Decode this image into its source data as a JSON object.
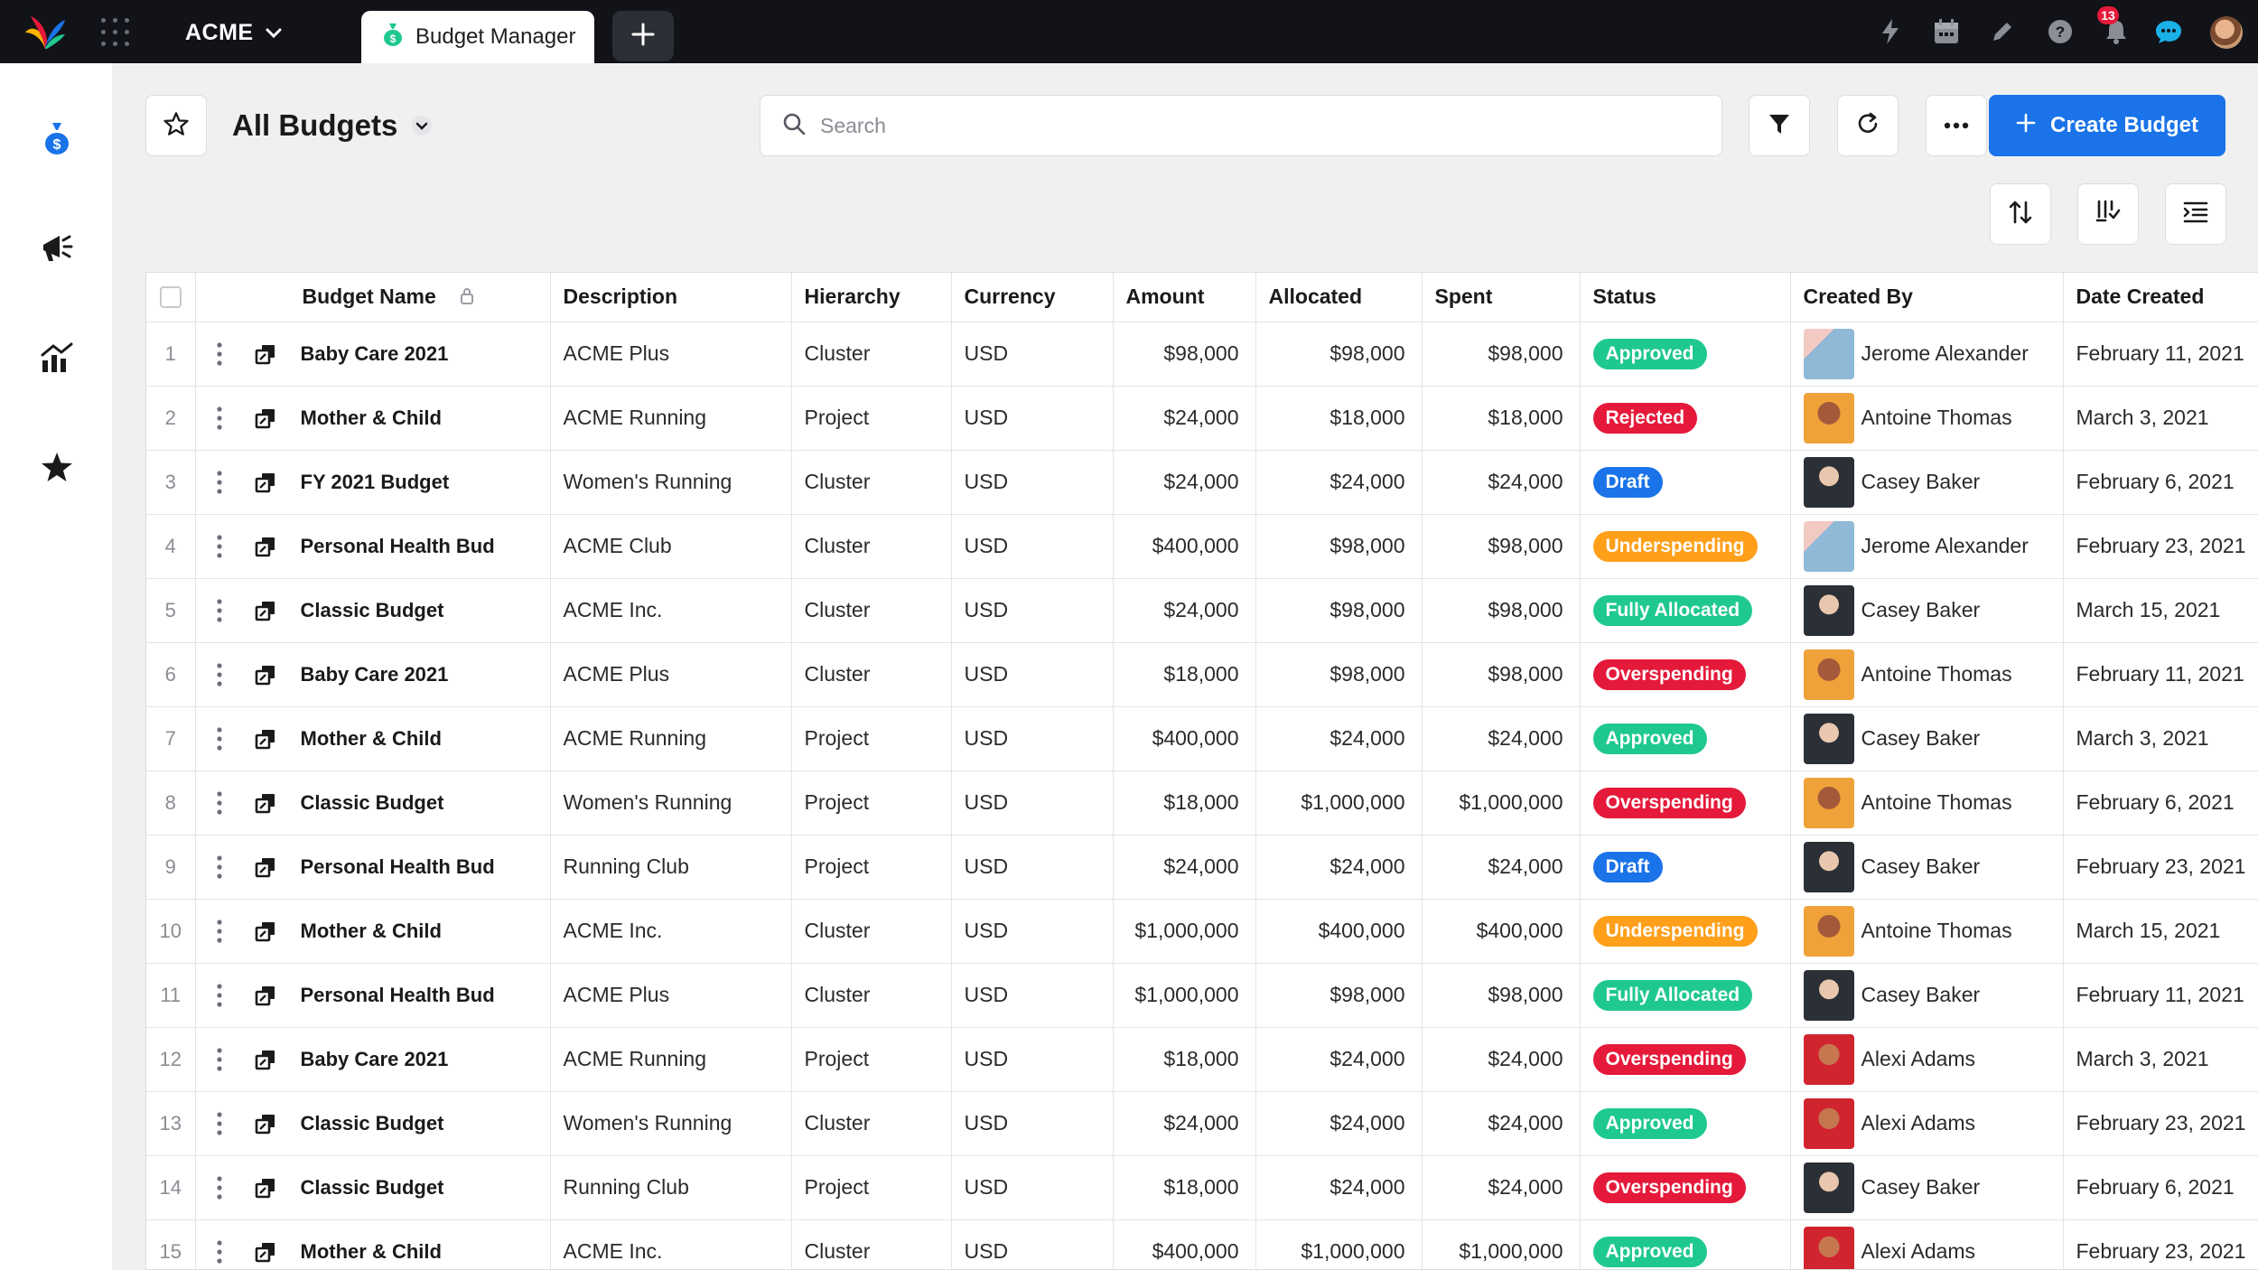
{
  "topbar": {
    "org_name": "ACME",
    "active_tab_label": "Budget Manager",
    "notification_count": "13",
    "colors": {
      "bg": "#121318",
      "badge": "#e5193a"
    }
  },
  "rail": {
    "items": [
      {
        "name": "budget-icon"
      },
      {
        "name": "megaphone-icon"
      },
      {
        "name": "analytics-icon"
      },
      {
        "name": "favorites-star-icon"
      }
    ]
  },
  "toolbar": {
    "view_title": "All Budgets",
    "search_placeholder": "Search",
    "create_label": "Create Budget",
    "accent": "#1a73e8"
  },
  "table": {
    "columns": [
      "Budget Name",
      "Description",
      "Hierarchy",
      "Currency",
      "Amount",
      "Allocated",
      "Spent",
      "Status",
      "Created By",
      "Date Created"
    ],
    "status_colors": {
      "Approved": "#1fc98e",
      "Rejected": "#e5193a",
      "Draft": "#1a73e8",
      "Underspending": "#ff9f1a",
      "Fully Allocated": "#1fc98e",
      "Overspending": "#e5193a"
    },
    "rows": [
      {
        "n": "1",
        "name": "Baby Care 2021",
        "desc": "ACME Plus",
        "hier": "Cluster",
        "cur": "USD",
        "amount": "$98,000",
        "allocated": "$98,000",
        "spent": "$98,000",
        "status": "Approved",
        "creator": "Jerome Alexander",
        "date": "February 11, 2021"
      },
      {
        "n": "2",
        "name": "Mother & Child",
        "desc": "ACME Running",
        "hier": "Project",
        "cur": "USD",
        "amount": "$24,000",
        "allocated": "$18,000",
        "spent": "$18,000",
        "status": "Rejected",
        "creator": "Antoine Thomas",
        "date": "March 3, 2021"
      },
      {
        "n": "3",
        "name": "FY 2021 Budget",
        "desc": "Women's Running",
        "hier": "Cluster",
        "cur": "USD",
        "amount": "$24,000",
        "allocated": "$24,000",
        "spent": "$24,000",
        "status": "Draft",
        "creator": "Casey Baker",
        "date": "February 6, 2021"
      },
      {
        "n": "4",
        "name": "Personal Health Bud",
        "desc": "ACME Club",
        "hier": "Cluster",
        "cur": "USD",
        "amount": "$400,000",
        "allocated": "$98,000",
        "spent": "$98,000",
        "status": "Underspending",
        "creator": "Jerome Alexander",
        "date": "February 23, 2021"
      },
      {
        "n": "5",
        "name": "Classic Budget",
        "desc": "ACME Inc.",
        "hier": "Cluster",
        "cur": "USD",
        "amount": "$24,000",
        "allocated": "$98,000",
        "spent": "$98,000",
        "status": "Fully Allocated",
        "creator": "Casey Baker",
        "date": "March 15, 2021"
      },
      {
        "n": "6",
        "name": "Baby Care 2021",
        "desc": "ACME Plus",
        "hier": "Cluster",
        "cur": "USD",
        "amount": "$18,000",
        "allocated": "$98,000",
        "spent": "$98,000",
        "status": "Overspending",
        "creator": "Antoine Thomas",
        "date": "February 11, 2021"
      },
      {
        "n": "7",
        "name": "Mother & Child",
        "desc": "ACME Running",
        "hier": "Project",
        "cur": "USD",
        "amount": "$400,000",
        "allocated": "$24,000",
        "spent": "$24,000",
        "status": "Approved",
        "creator": "Casey Baker",
        "date": "March 3, 2021"
      },
      {
        "n": "8",
        "name": "Classic Budget",
        "desc": "Women's Running",
        "hier": "Project",
        "cur": "USD",
        "amount": "$18,000",
        "allocated": "$1,000,000",
        "spent": "$1,000,000",
        "status": "Overspending",
        "creator": "Antoine Thomas",
        "date": "February 6, 2021"
      },
      {
        "n": "9",
        "name": "Personal Health Bud",
        "desc": "Running Club",
        "hier": "Project",
        "cur": "USD",
        "amount": "$24,000",
        "allocated": "$24,000",
        "spent": "$24,000",
        "status": "Draft",
        "creator": "Casey Baker",
        "date": "February 23, 2021"
      },
      {
        "n": "10",
        "name": "Mother & Child",
        "desc": "ACME Inc.",
        "hier": "Cluster",
        "cur": "USD",
        "amount": "$1,000,000",
        "allocated": "$400,000",
        "spent": "$400,000",
        "status": "Underspending",
        "creator": "Antoine Thomas",
        "date": "March 15, 2021"
      },
      {
        "n": "11",
        "name": "Personal Health Bud",
        "desc": "ACME Plus",
        "hier": "Cluster",
        "cur": "USD",
        "amount": "$1,000,000",
        "allocated": "$98,000",
        "spent": "$98,000",
        "status": "Fully Allocated",
        "creator": "Casey Baker",
        "date": "February 11, 2021"
      },
      {
        "n": "12",
        "name": "Baby Care 2021",
        "desc": "ACME Running",
        "hier": "Project",
        "cur": "USD",
        "amount": "$18,000",
        "allocated": "$24,000",
        "spent": "$24,000",
        "status": "Overspending",
        "creator": "Alexi Adams",
        "date": "March 3, 2021"
      },
      {
        "n": "13",
        "name": "Classic Budget",
        "desc": "Women's Running",
        "hier": "Cluster",
        "cur": "USD",
        "amount": "$24,000",
        "allocated": "$24,000",
        "spent": "$24,000",
        "status": "Approved",
        "creator": "Alexi Adams",
        "date": "February 23, 2021"
      },
      {
        "n": "14",
        "name": "Classic Budget",
        "desc": "Running Club",
        "hier": "Project",
        "cur": "USD",
        "amount": "$18,000",
        "allocated": "$24,000",
        "spent": "$24,000",
        "status": "Overspending",
        "creator": "Casey Baker",
        "date": "February 6, 2021"
      },
      {
        "n": "15",
        "name": "Mother & Child",
        "desc": "ACME Inc.",
        "hier": "Cluster",
        "cur": "USD",
        "amount": "$400,000",
        "allocated": "$1,000,000",
        "spent": "$1,000,000",
        "status": "Approved",
        "creator": "Alexi Adams",
        "date": "February 23, 2021"
      }
    ]
  }
}
